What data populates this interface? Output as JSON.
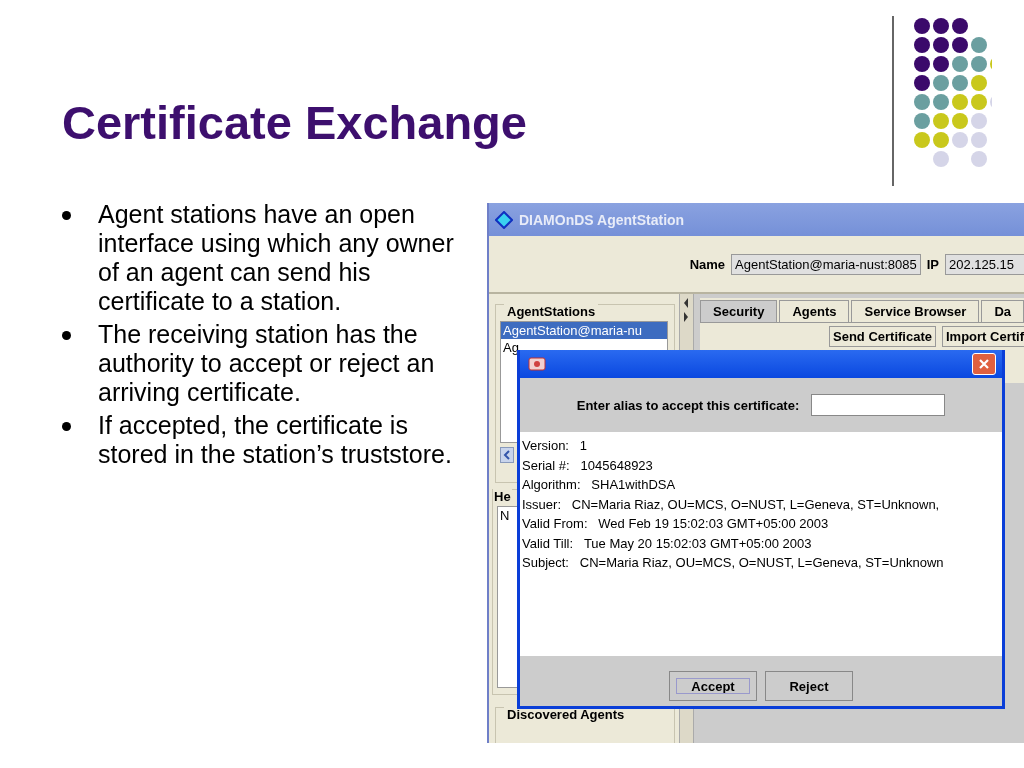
{
  "slide": {
    "title": "Certificate Exchange",
    "bullets": [
      "Agent stations have an open interface using which any owner of an agent can send his certificate to a station.",
      "The receiving station has the authority to accept or reject an arriving certificate.",
      "If accepted, the certificate is stored in the station’s truststore."
    ]
  },
  "app": {
    "title": "DIAMOnDS AgentStation",
    "name_label": "Name",
    "name_value": "AgentStation@maria-nust:8085",
    "ip_label": "IP",
    "ip_value": "202.125.15",
    "agent_stations": {
      "label": "AgentStations",
      "items": [
        {
          "text": "AgentStation@maria-nu",
          "selected": true
        },
        {
          "text": "Ag",
          "selected": false
        }
      ]
    },
    "group_2": {
      "label": "He",
      "items": [
        "N"
      ]
    },
    "discovered_agents": {
      "label": "Discovered Agents"
    },
    "tabs": [
      {
        "label": "Security",
        "selected": true
      },
      {
        "label": "Agents",
        "selected": false
      },
      {
        "label": "Service Browser",
        "selected": false
      },
      {
        "label": "Da",
        "selected": false
      }
    ],
    "buttons": [
      "Send Certificate",
      "Import Certif"
    ]
  },
  "dialog": {
    "prompt": "Enter alias to accept this certificate:",
    "details": [
      {
        "key": "Version:",
        "value": "1"
      },
      {
        "key": "Serial #:",
        "value": "1045648923"
      },
      {
        "key": "Algorithm:",
        "value": "SHA1withDSA"
      },
      {
        "key": "Issuer:",
        "value": "CN=Maria Riaz, OU=MCS, O=NUST, L=Geneva, ST=Unknown,"
      },
      {
        "key": "Valid From:",
        "value": "Wed Feb 19 15:02:03 GMT+05:00 2003"
      },
      {
        "key": "Valid Till:",
        "value": "Tue May 20 15:02:03 GMT+05:00 2003"
      },
      {
        "key": "Subject:",
        "value": "CN=Maria Riaz, OU=MCS, O=NUST, L=Geneva, ST=Unknown"
      }
    ],
    "buttons": [
      {
        "label": "Accept",
        "selected": true
      },
      {
        "label": "Reject",
        "selected": false
      }
    ]
  }
}
